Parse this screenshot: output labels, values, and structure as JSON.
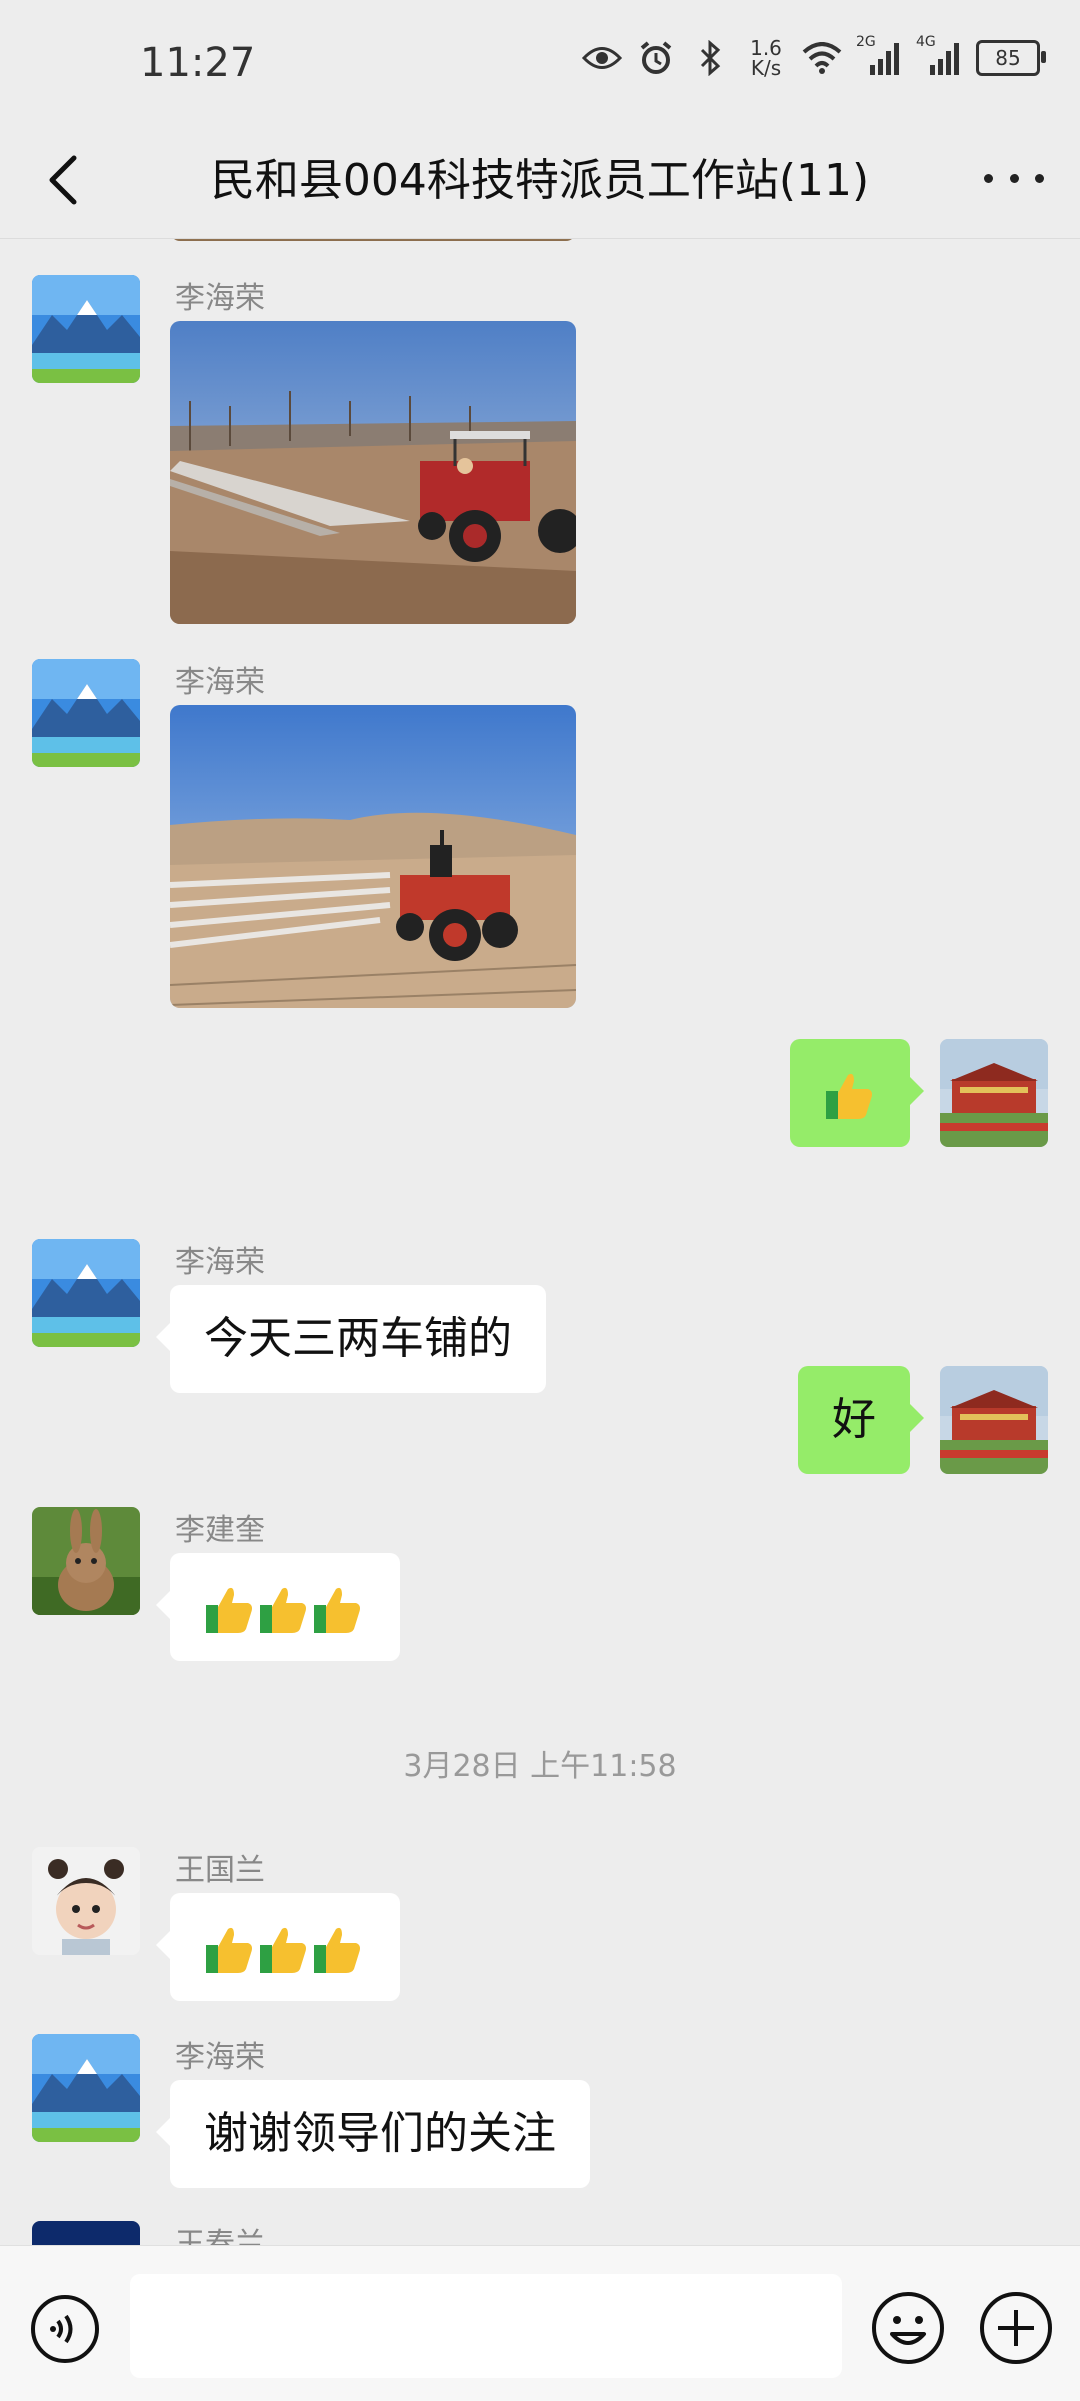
{
  "status_bar": {
    "time": "11:27",
    "net_speed_value": "1.6",
    "net_speed_unit": "K/s",
    "sim1_label": "2G",
    "sim2_label": "4G",
    "battery_level": "85"
  },
  "header": {
    "title": "民和县004科技特派员工作站(11)"
  },
  "messages": [
    {
      "sender": "李海荣",
      "type": "image",
      "content": "tractor-field-photo-1"
    },
    {
      "sender": "李海荣",
      "type": "image",
      "content": "tractor-field-photo-2"
    },
    {
      "sender": "me",
      "type": "emoji",
      "content": "thumbs-up"
    },
    {
      "sender": "李海荣",
      "type": "text",
      "content": "今天三两车铺的"
    },
    {
      "sender": "me",
      "type": "text",
      "content": "好"
    },
    {
      "sender": "李建奎",
      "type": "emoji",
      "content": "thumbs-up x3"
    },
    {
      "sender": "王国兰",
      "type": "emoji",
      "content": "thumbs-up x3"
    },
    {
      "sender": "李海荣",
      "type": "text",
      "content": "谢谢领导们的关注"
    },
    {
      "sender": "王春兰",
      "type": "partial",
      "content": ""
    }
  ],
  "timestamp": "3月28日 上午11:58",
  "input_bar": {
    "placeholder": "",
    "icons": [
      "voice-icon",
      "emoji-icon",
      "plus-icon"
    ]
  },
  "colors": {
    "background": "#ededed",
    "my_bubble": "#95ec69",
    "other_bubble": "#ffffff",
    "sender_name": "#888888"
  }
}
